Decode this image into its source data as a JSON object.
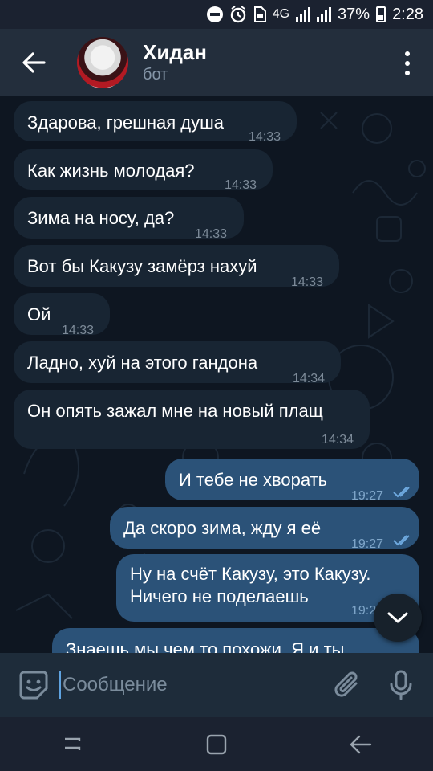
{
  "status_bar": {
    "network": "4G",
    "battery": "37%",
    "time": "2:28"
  },
  "header": {
    "title": "Хидан",
    "subtitle": "бот",
    "back_icon": "arrow-left-icon",
    "menu_icon": "more-vertical-icon"
  },
  "messages": [
    {
      "dir": "in",
      "text": "Здарова, грешная душа",
      "time": "14:33"
    },
    {
      "dir": "in",
      "text": "Как жизнь молодая?",
      "time": "14:33"
    },
    {
      "dir": "in",
      "text": "Зима на носу, да?",
      "time": "14:33"
    },
    {
      "dir": "in",
      "text": "Вот бы Какузу замёрз нахуй",
      "time": "14:33"
    },
    {
      "dir": "in",
      "text": "Ой",
      "time": "14:33"
    },
    {
      "dir": "in",
      "text": "Ладно, хуй на этого гандона",
      "time": "14:34"
    },
    {
      "dir": "in",
      "text": "Он опять зажал мне на новый плащ",
      "time": "14:34"
    },
    {
      "dir": "out",
      "text": "И тебе не хворать",
      "time": "19:27",
      "read": true
    },
    {
      "dir": "out",
      "text": "Да скоро зима, жду я её",
      "time": "19:27",
      "read": true
    },
    {
      "dir": "out",
      "text_line1": "Ну на счёт Какузу,  это Какузу.",
      "text_line2": "Ничего не поделаешь",
      "time": "19:2"
    },
    {
      "dir": "out",
      "text": "Знаешь мы чем то похожи. Я и ты"
    }
  ],
  "composer": {
    "placeholder": "Сообщение",
    "emoji_icon": "sticker-smile-icon",
    "attach_icon": "paperclip-icon",
    "mic_icon": "microphone-icon"
  },
  "colors": {
    "accent": "#5fa3e0",
    "bubble_in": "#182533",
    "bubble_out": "#2b5278",
    "header": "#232e3c"
  }
}
